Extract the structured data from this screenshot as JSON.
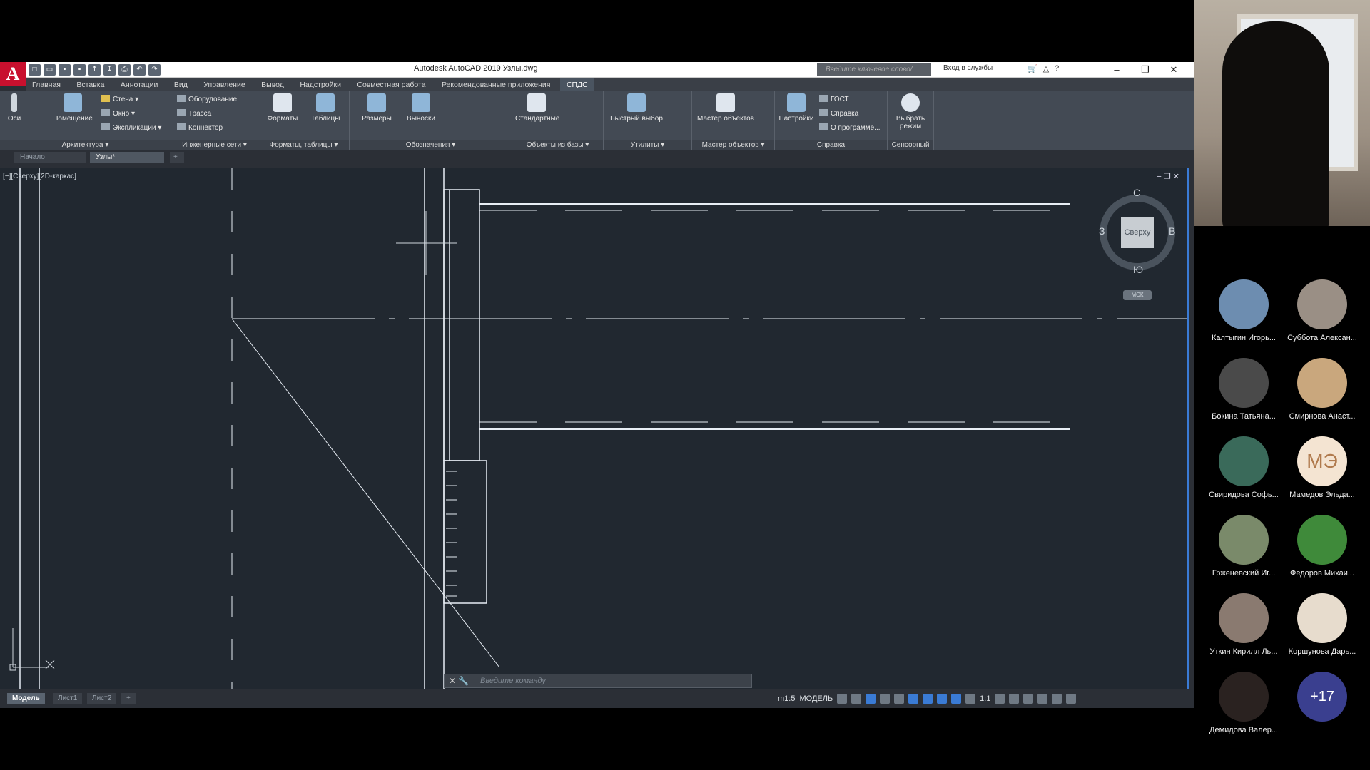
{
  "app": {
    "logo": "A",
    "title": "Autodesk AutoCAD 2019   Узлы.dwg",
    "search_placeholder": "Введите ключевое слово/фразу",
    "signin": "Вход в службы",
    "window_controls": [
      "–",
      "❐",
      "✕"
    ]
  },
  "ribbon_tabs": [
    "Главная",
    "Вставка",
    "Аннотации",
    "Вид",
    "Управление",
    "Вывод",
    "Надстройки",
    "Совместная работа",
    "Рекомендованные приложения",
    "СПДС"
  ],
  "ribbon": {
    "arch": {
      "label": "Архитектура ▾",
      "btns": [
        "Оси",
        "Помещение"
      ],
      "small": [
        "Стена ▾",
        "Окно ▾",
        "Экспликации ▾"
      ]
    },
    "eng": {
      "label": "Инженерные сети ▾",
      "small": [
        "Оборудование",
        "Трасса",
        "Коннектор"
      ]
    },
    "formats": {
      "label": "Форматы, таблицы ▾",
      "btns": [
        "Форматы",
        "Таблицы"
      ]
    },
    "marks": {
      "label": "Обозначения ▾",
      "btns": [
        "Размеры",
        "Выноски"
      ]
    },
    "objects": {
      "label": "Объекты из базы ▾",
      "btns": [
        "Стандартные"
      ]
    },
    "utils": {
      "label": "Утилиты ▾",
      "btns": [
        "Быстрый выбор"
      ]
    },
    "master": {
      "label": "Мастер объектов ▾",
      "btns": [
        "Мастер объектов"
      ]
    },
    "help": {
      "label": "Справка",
      "btns": [
        "Настройки"
      ],
      "small": [
        "ГОСТ",
        "Справка",
        "О программе..."
      ]
    },
    "touch": {
      "label": "Сенсорный",
      "btns": [
        "Выбрать режим"
      ]
    }
  },
  "doc_tabs": [
    "Начало",
    "Узлы*"
  ],
  "viewport": {
    "label": "[−][Сверху][2D-каркас]",
    "viewcube": {
      "top": "Сверху",
      "n": "С",
      "s": "Ю",
      "w": "З",
      "e": "В",
      "ucs": "МСК"
    }
  },
  "command": {
    "placeholder": "Введите команду"
  },
  "layout_tabs": [
    "Модель",
    "Лист1",
    "Лист2"
  ],
  "status": {
    "scale": "m1:5",
    "mode": "МОДЕЛЬ",
    "annoscale": "1:1"
  },
  "participants": [
    {
      "name": "Калтыгин Игорь...",
      "color": "#6d8db0"
    },
    {
      "name": "Суббота Алексан...",
      "color": "#9a8f85"
    },
    {
      "name": "Бокина Татьяна...",
      "color": "#4a4a4a"
    },
    {
      "name": "Смирнова Анаст...",
      "color": "#c9a77d"
    },
    {
      "name": "Свиридова Софь...",
      "color": "#3a6a5a"
    },
    {
      "name": "Мамедов Эльда...",
      "initials": "МЭ"
    },
    {
      "name": "Грженевский Иг...",
      "color": "#7a8a6a"
    },
    {
      "name": "Федоров Михаи...",
      "color": "#3f8a3a"
    },
    {
      "name": "Уткин Кирилл Ль...",
      "color": "#8a7a70"
    },
    {
      "name": "Коршунова Дарь...",
      "color": "#e7dccd"
    },
    {
      "name": "Демидова Валер...",
      "color": "#2a2220"
    },
    {
      "name": "",
      "more": "+17"
    }
  ]
}
